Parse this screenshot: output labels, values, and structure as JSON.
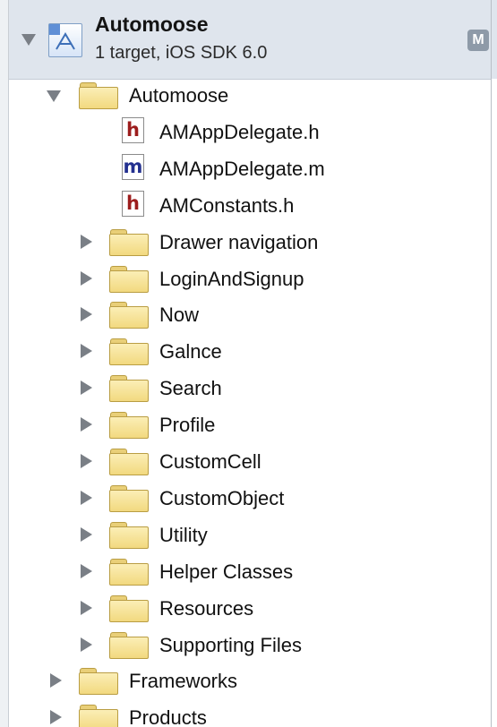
{
  "project": {
    "title": "Automoose",
    "subtitle": "1 target, iOS SDK 6.0",
    "badge": "M"
  },
  "tree": [
    {
      "label": "Automoose",
      "kind": "folder",
      "depth": 1,
      "expanded": true
    },
    {
      "label": "AMAppDelegate.h",
      "kind": "file",
      "type": "h",
      "depth": 2
    },
    {
      "label": "AMAppDelegate.m",
      "kind": "file",
      "type": "m",
      "depth": 2
    },
    {
      "label": "AMConstants.h",
      "kind": "file",
      "type": "h",
      "depth": 2
    },
    {
      "label": "Drawer navigation",
      "kind": "folder",
      "depth": 2,
      "expanded": false
    },
    {
      "label": "LoginAndSignup",
      "kind": "folder",
      "depth": 2,
      "expanded": false
    },
    {
      "label": "Now",
      "kind": "folder",
      "depth": 2,
      "expanded": false
    },
    {
      "label": "Galnce",
      "kind": "folder",
      "depth": 2,
      "expanded": false
    },
    {
      "label": "Search",
      "kind": "folder",
      "depth": 2,
      "expanded": false
    },
    {
      "label": "Profile",
      "kind": "folder",
      "depth": 2,
      "expanded": false
    },
    {
      "label": "CustomCell",
      "kind": "folder",
      "depth": 2,
      "expanded": false
    },
    {
      "label": "CustomObject",
      "kind": "folder",
      "depth": 2,
      "expanded": false
    },
    {
      "label": "Utility",
      "kind": "folder",
      "depth": 2,
      "expanded": false
    },
    {
      "label": "Helper Classes",
      "kind": "folder",
      "depth": 2,
      "expanded": false
    },
    {
      "label": "Resources",
      "kind": "folder",
      "depth": 2,
      "expanded": false
    },
    {
      "label": "Supporting Files",
      "kind": "folder",
      "depth": 2,
      "expanded": false
    },
    {
      "label": "Frameworks",
      "kind": "folder",
      "depth": 1,
      "expanded": false
    },
    {
      "label": "Products",
      "kind": "folder",
      "depth": 1,
      "expanded": false
    }
  ],
  "icons": {
    "folder": "folder-icon",
    "header_file": "header-file-icon",
    "implementation_file": "objc-file-icon",
    "project": "xcode-project-icon",
    "disclosure_open": "disclosure-open-icon",
    "disclosure_closed": "disclosure-closed-icon"
  },
  "colors": {
    "header_background": "#dfe5ed",
    "h_glyph": "#9c1d1d",
    "m_glyph": "#23308f",
    "folder_fill": "#f2d97f",
    "disclosure": "#7a7f86"
  }
}
